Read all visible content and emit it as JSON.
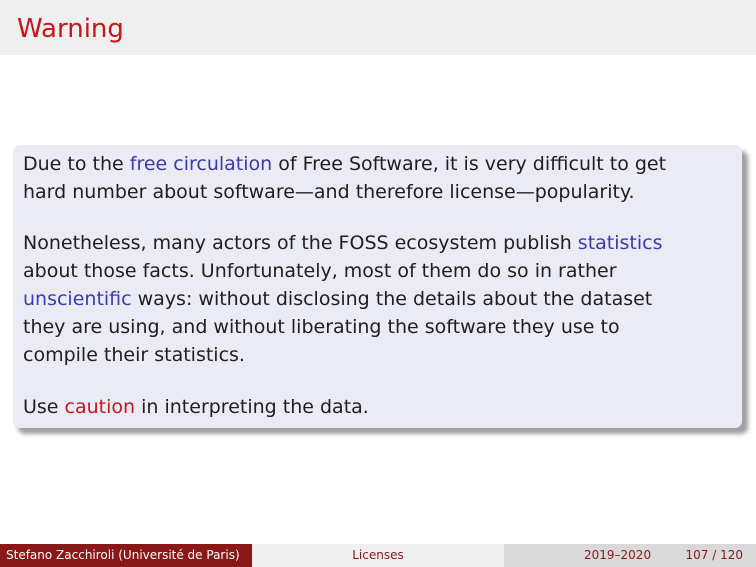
{
  "slide": {
    "title": "Warning"
  },
  "block": {
    "paragraph1": {
      "before": "Due to the ",
      "highlight": "free circulation",
      "after_line1": " of Free Software, it is very difficult to get",
      "line2": "hard number about software—and therefore license—popularity."
    },
    "paragraph2": {
      "line1_before": "Nonetheless, many actors of the FOSS ecosystem publish ",
      "line1_highlight": "statistics",
      "line2": "about those facts. Unfortunately, most of them do so in rather",
      "line3_highlight": "unscientific",
      "line3_after": " ways: without disclosing the details about the dataset",
      "line4": "they are using, and without liberating the software they use to",
      "line5": "compile their statistics."
    },
    "paragraph3": {
      "before": "Use ",
      "highlight": "caution",
      "after": " in interpreting the data."
    }
  },
  "footer": {
    "author": "Stefano Zacchiroli  (Université de Paris)",
    "title": "Licenses",
    "date": "2019–2020",
    "page": "107 / 120"
  },
  "colors": {
    "accent_red": "#c4161c",
    "highlight_blue": "#3a3ab0",
    "footer_dark_red": "#8b1818",
    "block_background": "#ebebf6"
  }
}
